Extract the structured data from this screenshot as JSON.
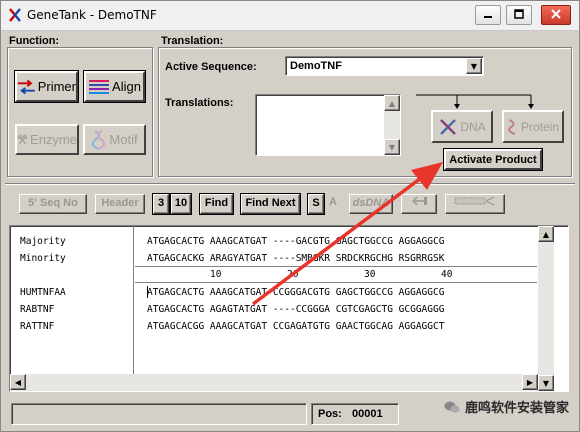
{
  "window": {
    "title": "GeneTank - DemoTNF"
  },
  "function_panel": {
    "label": "Function:",
    "primer_label": "Primer",
    "align_label": "Align",
    "enzyme_label": "Enzyme",
    "motif_label": "Motif"
  },
  "translation_panel": {
    "label": "Translation:",
    "active_sequence_label": "Active Sequence:",
    "active_sequence_value": "DemoTNF",
    "translations_label": "Translations:",
    "dna_label": "DNA",
    "protein_label": "Protein",
    "activate_product_label": "Activate Product"
  },
  "toolbar": {
    "seq_no": "5' Seq No",
    "header": "Header",
    "n3": "3",
    "n10": "10",
    "find": "Find",
    "find_next": "Find Next",
    "s": "S",
    "a": "A",
    "dsdna": "dsDNA"
  },
  "sequences": {
    "consensus": [
      {
        "name": "Majority",
        "seq": "ATGAGCACTG AAAGCATGAT ----GACGTG GAGCTGGCCG AGGAGGCG"
      },
      {
        "name": "Minority",
        "seq": "ATGAGCACKG ARAGYATGAT ----SMBGKR SRDCKRGCHG RSGRRGSK"
      }
    ],
    "ruler": [
      "10",
      "20",
      "30",
      "40"
    ],
    "rows": [
      {
        "name": "HUMTNFAA",
        "seq": "ATGAGCACTG AAAGCATGAT CCGGGACGTG GAGCTGGCCG AGGAGGCG"
      },
      {
        "name": "RABTNF",
        "seq": "ATGAGCACTG AGAGTATGAT ----CCGGGA CGTCGAGCTG GCGGAGGG"
      },
      {
        "name": "RATTNF",
        "seq": "ATGAGCACGG AAAGCATGAT CCGAGATGTG GAACTGGCAG AGGAGGCT"
      }
    ]
  },
  "status": {
    "pos_label": "Pos:",
    "pos_value": "00001"
  },
  "watermark": "鹿鸣软件安装管家",
  "colors": {
    "arrow": "#e8352b",
    "titlebar": "#f0f0f0",
    "face": "#d4d0c8"
  }
}
